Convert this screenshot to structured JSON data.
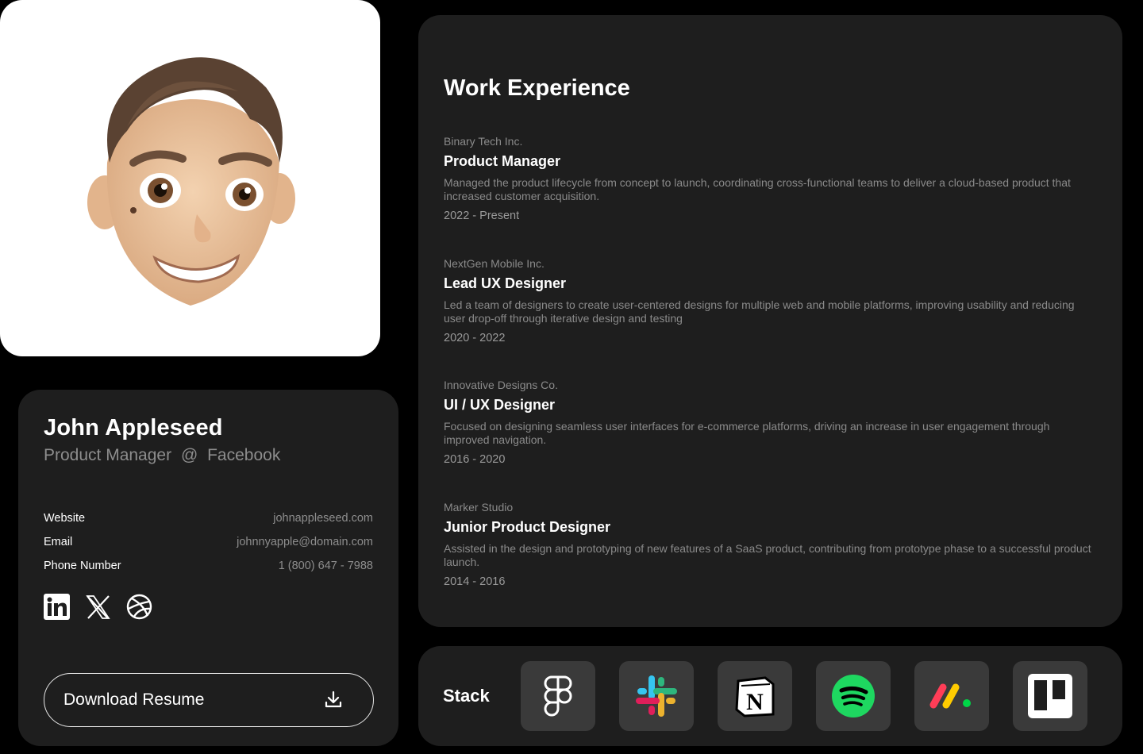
{
  "profile": {
    "name": "John Appleseed",
    "role": "Product Manager",
    "at": "@",
    "company": "Facebook",
    "contact": [
      {
        "label": "Website",
        "value": "johnappleseed.com"
      },
      {
        "label": "Email",
        "value": "johnnyapple@domain.com"
      },
      {
        "label": "Phone Number",
        "value": "1 (800) 647 - 7988"
      }
    ],
    "socials": [
      "linkedin-icon",
      "x-icon",
      "dribbble-icon"
    ],
    "download_label": "Download Resume"
  },
  "work": {
    "title": "Work Experience",
    "jobs": [
      {
        "company": "Binary Tech Inc.",
        "position": "Product Manager",
        "description": "Managed the product lifecycle from concept to launch, coordinating cross-functional teams to deliver a cloud-based product that increased customer acquisition.",
        "dates": "2022 - Present"
      },
      {
        "company": "NextGen Mobile Inc.",
        "position": "Lead UX Designer",
        "description": "Led a team of designers to create user-centered designs for multiple web and mobile platforms, improving usability and reducing user drop-off through iterative design and testing",
        "dates": "2020 - 2022"
      },
      {
        "company": "Innovative Designs Co.",
        "position": "UI / UX Designer",
        "description": "Focused on designing seamless user interfaces for e-commerce platforms, driving an increase in user engagement through improved navigation.",
        "dates": "2016 - 2020"
      },
      {
        "company": "Marker Studio",
        "position": "Junior Product Designer",
        "description": "Assisted in the design and prototyping of new features of a SaaS product, contributing from prototype phase to a successful product launch.",
        "dates": "2014 - 2016"
      }
    ]
  },
  "stack": {
    "label": "Stack",
    "tools": [
      "figma-icon",
      "slack-icon",
      "notion-icon",
      "spotify-icon",
      "monday-icon",
      "trello-icon"
    ]
  },
  "colors": {
    "background": "#000000",
    "card": "#1e1e1e",
    "muted_text": "#8d8d8d",
    "tile": "#3a3a3a"
  }
}
